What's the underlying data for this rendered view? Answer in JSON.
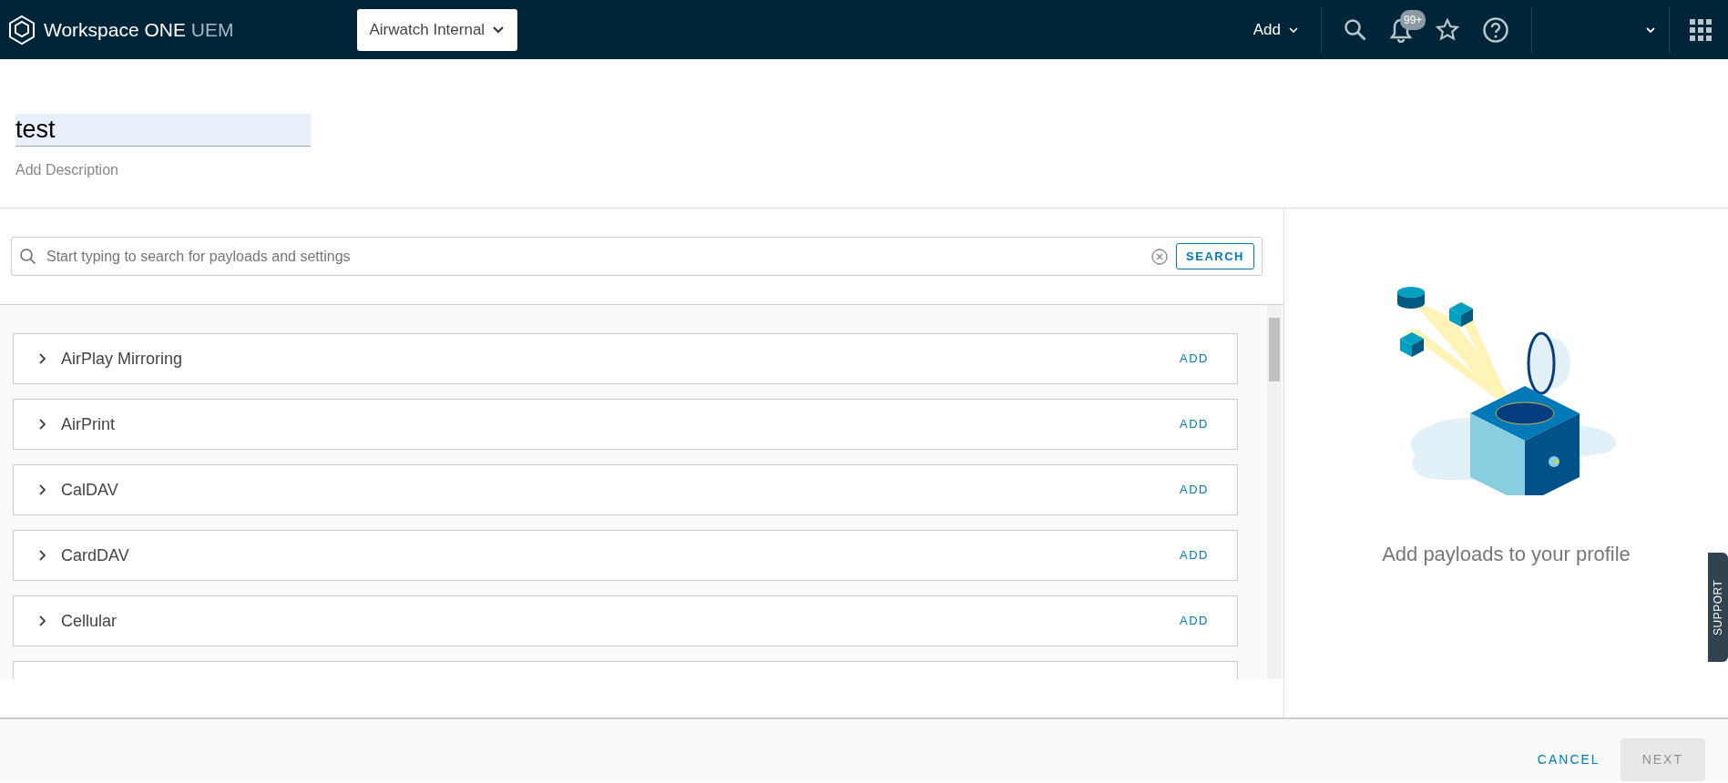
{
  "header": {
    "brand": "Workspace ONE",
    "brand_suffix": "UEM",
    "org_selector": "Airwatch Internal",
    "add_menu": "Add",
    "notification_badge": "99+"
  },
  "profile": {
    "name": "test",
    "description_placeholder": "Add Description"
  },
  "search": {
    "placeholder": "Start typing to search for payloads and settings",
    "button": "SEARCH"
  },
  "payloads": [
    {
      "name": "AirPlay Mirroring",
      "action": "ADD",
      "expanded": false
    },
    {
      "name": "AirPrint",
      "action": "ADD",
      "expanded": false
    },
    {
      "name": "CalDAV",
      "action": "ADD",
      "expanded": false
    },
    {
      "name": "CardDAV",
      "action": "ADD",
      "expanded": false
    },
    {
      "name": "Cellular",
      "action": "ADD",
      "expanded": false
    }
  ],
  "empty_state": {
    "message": "Add payloads to your profile"
  },
  "support_tab": "SUPPORT",
  "footer": {
    "cancel": "CANCEL",
    "next": {
      "label": "NEXT",
      "disabled": true
    }
  }
}
